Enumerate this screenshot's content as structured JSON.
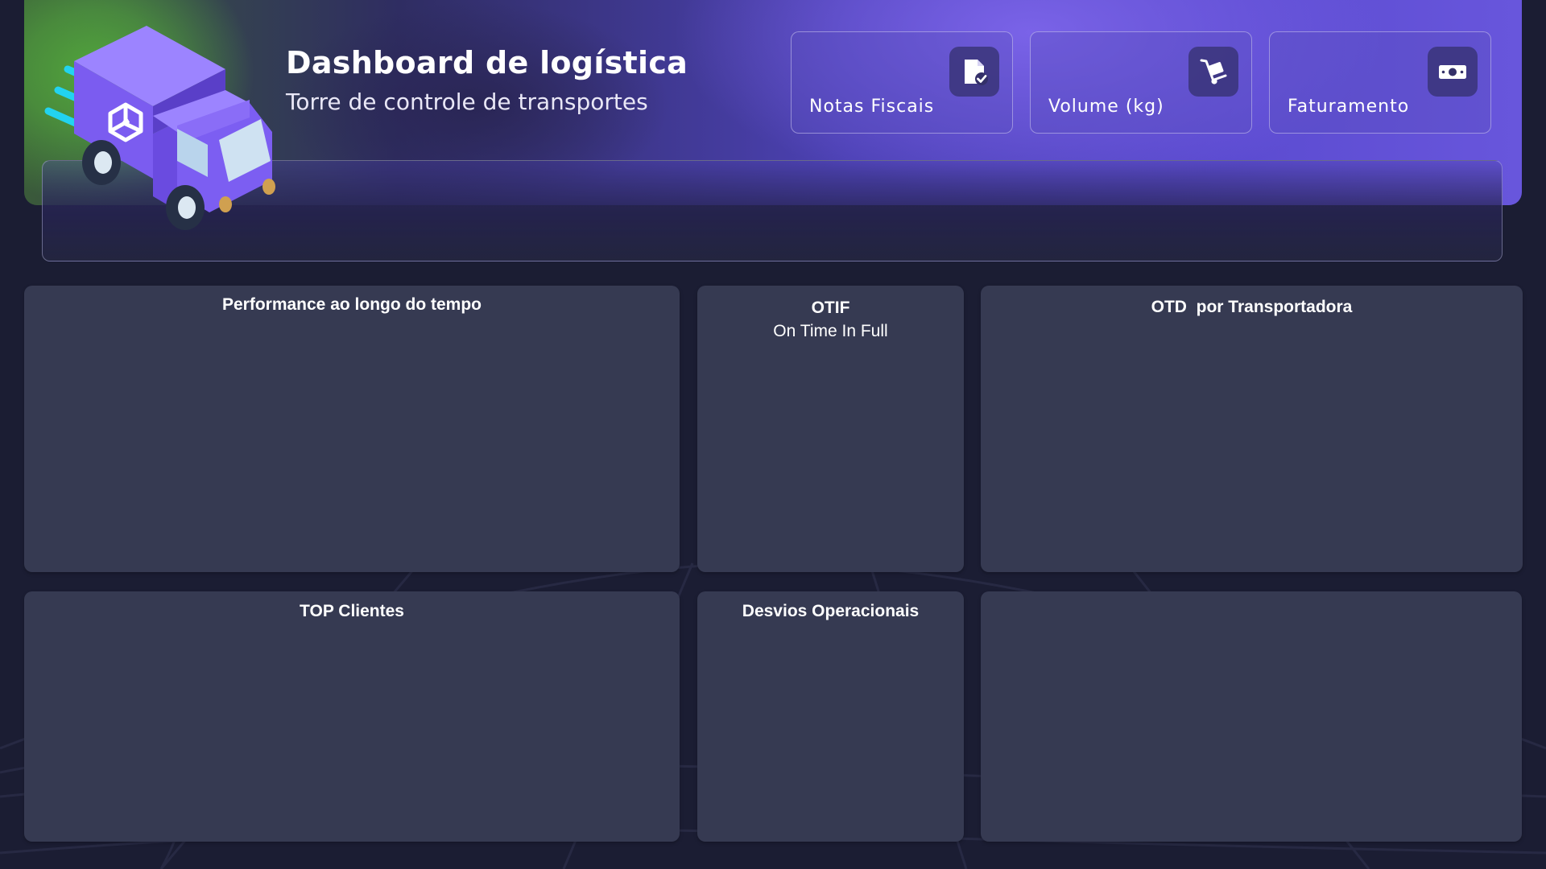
{
  "header": {
    "title": "Dashboard de logística",
    "subtitle": "Torre de controle de transportes",
    "illustration": "delivery-truck"
  },
  "kpi_cards": [
    {
      "label": "Notas Fiscais",
      "icon": "invoice-check-icon"
    },
    {
      "label": "Volume (kg)",
      "icon": "hand-truck-icon"
    },
    {
      "label": "Faturamento",
      "icon": "cash-icon"
    }
  ],
  "panels": {
    "performance": {
      "title": "Performance ao longo do tempo"
    },
    "otif": {
      "title": "OTIF",
      "subtitle": "On Time In Full"
    },
    "otd": {
      "title": "OTD  por Transportadora"
    },
    "top_clientes": {
      "title": "TOP Clientes"
    },
    "desvios": {
      "title": "Desvios Operacionais"
    },
    "empty": {
      "title": ""
    }
  },
  "colors": {
    "background": "#1b1d33",
    "panel": "#363a52",
    "banner_purple": "#5b4bd0",
    "banner_green": "#52a63c",
    "truck_body": "#7b5cf0",
    "speed_lines": "#22d3f0"
  }
}
